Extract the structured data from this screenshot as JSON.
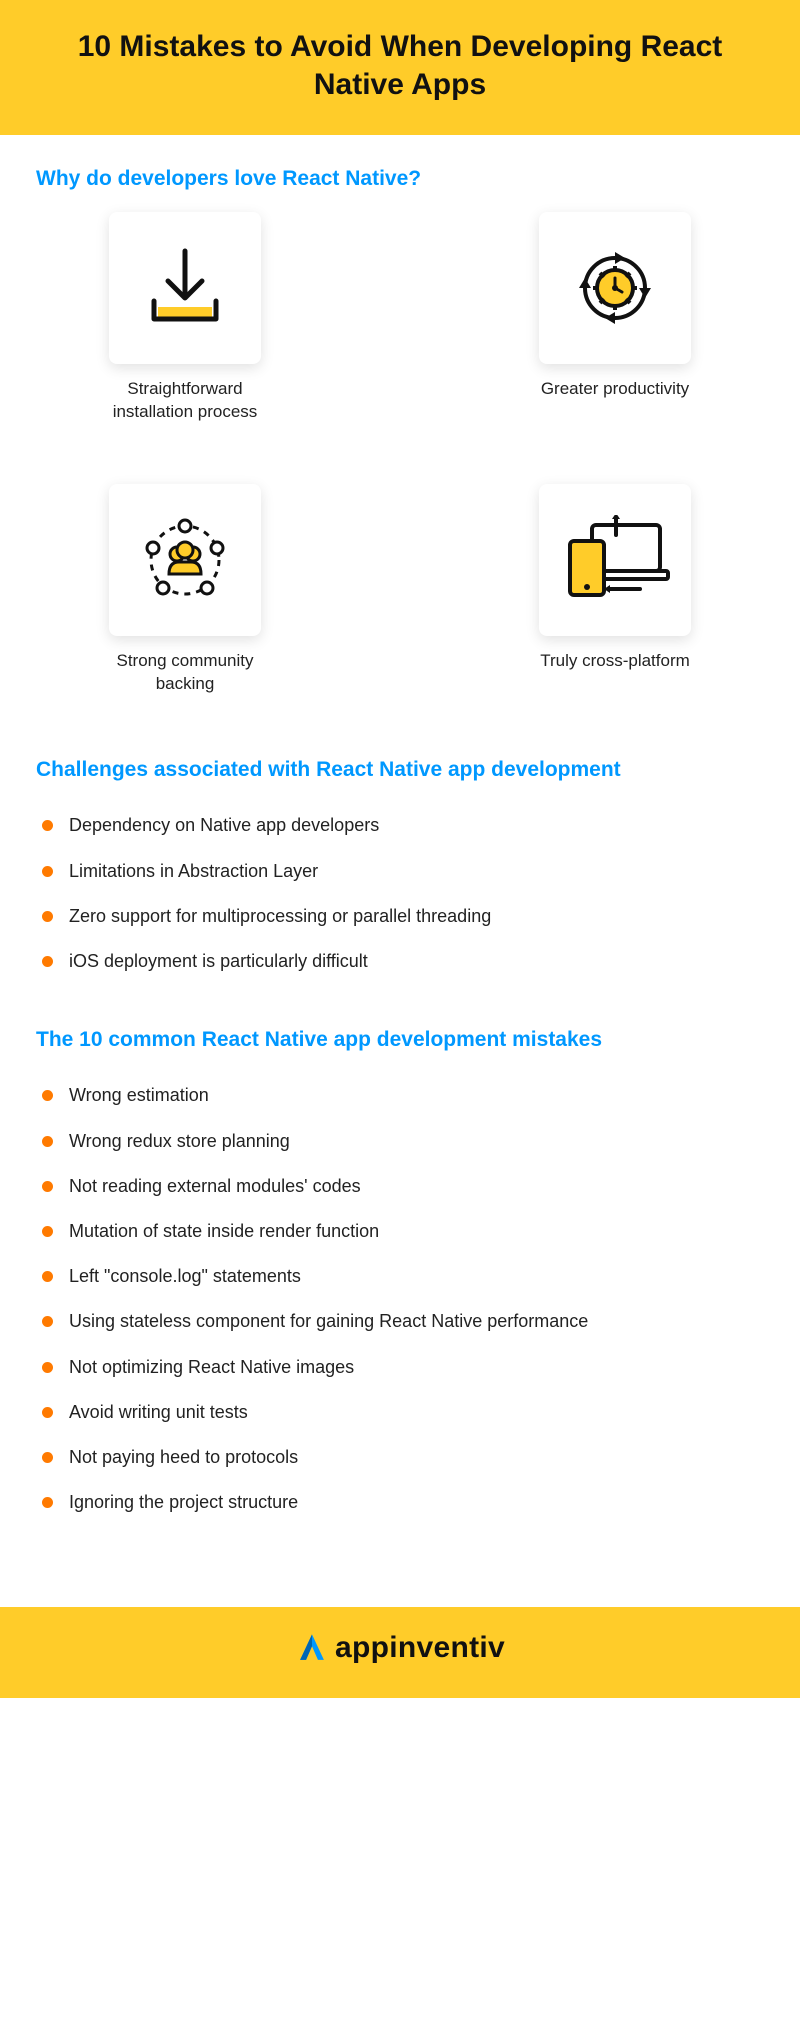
{
  "header": {
    "title": "10 Mistakes to Avoid When Developing React Native Apps"
  },
  "sections": {
    "love": {
      "heading": "Why do developers love React Native?",
      "cards": [
        {
          "label": "Straightforward installation process"
        },
        {
          "label": "Greater productivity"
        },
        {
          "label": "Strong community backing"
        },
        {
          "label": "Truly cross-platform"
        }
      ]
    },
    "challenges": {
      "heading": "Challenges associated with React Native app development",
      "items": [
        "Dependency on Native app developers",
        "Limitations in Abstraction Layer",
        "Zero support for multiprocessing or parallel threading",
        "iOS deployment is particularly difficult"
      ]
    },
    "mistakes": {
      "heading": "The 10 common React Native app development mistakes",
      "items": [
        "Wrong estimation",
        "Wrong redux store planning",
        "Not reading external modules' codes",
        "Mutation of state inside render function",
        "Left \"console.log\" statements",
        "Using stateless component for gaining React Native performance",
        "Not optimizing React Native images",
        "Avoid writing unit tests",
        "Not paying heed to protocols",
        "Ignoring the project structure"
      ]
    }
  },
  "footer": {
    "brand": "appinventiv"
  }
}
